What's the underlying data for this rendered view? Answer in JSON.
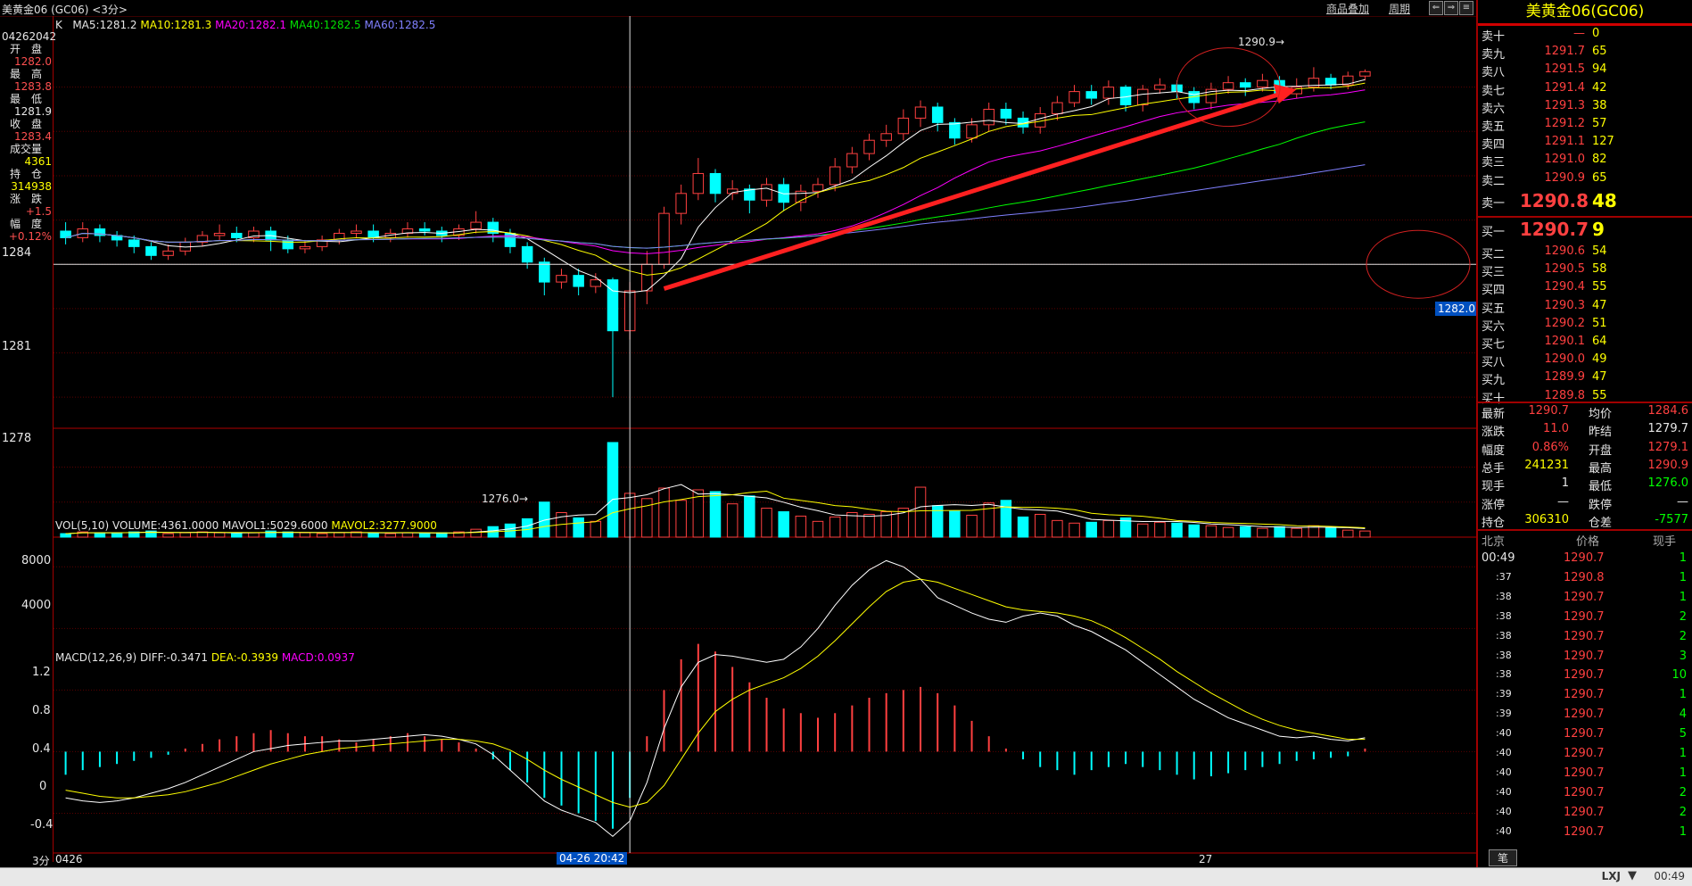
{
  "window": {
    "title": "美黄金06 (GC06) <3分>",
    "link_overlay": "商品叠加",
    "link_period": "周期"
  },
  "sidebar": {
    "code": "04262042",
    "open_label": "开　盘",
    "open_value": "1282.0",
    "high_label": "最　高",
    "high_value": "1283.8",
    "low_label": "最　低",
    "low_value": "1281.9",
    "close_label": "收　盘",
    "close_value": "1283.4",
    "vol_label": "成交量",
    "vol_value": "4361",
    "oi_label": "持　仓",
    "oi_value": "314938",
    "chg_label": "涨　跌",
    "chg_value": "+1.5",
    "pct_label": "幅　度",
    "pct_value": "+0.12%"
  },
  "main_chart": {
    "k_label": "K",
    "ma5": "MA5:1281.2",
    "ma10": "MA10:1281.3",
    "ma20": "MA20:1282.1",
    "ma40": "MA40:1282.5",
    "ma60": "MA60:1282.5",
    "y_ticks": [
      "1284",
      "1281",
      "1278"
    ],
    "annot_high": "1290.9",
    "annot_low": "1276.0",
    "crosshair_price": "1282.0"
  },
  "volume_chart": {
    "title": "VOL(5,10) VOLUME:4361.0000",
    "mavol1": "MAVOL1:5029.6000",
    "mavol2": "MAVOL2:3277.9000",
    "y_ticks": [
      "8000",
      "4000"
    ]
  },
  "macd_chart": {
    "title": "MACD(12,26,9)",
    "diff": "DIFF:-0.3471",
    "dea": "DEA:-0.3939",
    "macd": "MACD:0.0937",
    "y_ticks": [
      "1.2",
      "0.8",
      "0.4",
      "0",
      "-0.4"
    ]
  },
  "xaxis": {
    "period": "3分",
    "start": "0426",
    "cursor_time": "04-26 20:42",
    "mid_label": "27"
  },
  "chart_data": {
    "type": "candlestick",
    "price_range": [
      1275,
      1292
    ],
    "volume_range": [
      0,
      11000
    ],
    "macd_range": [
      -0.6,
      1.3
    ],
    "candles": [
      {
        "o": 1283.5,
        "c": 1283.2,
        "h": 1283.9,
        "l": 1282.9
      },
      {
        "o": 1283.2,
        "c": 1283.6,
        "h": 1283.9,
        "l": 1283.0
      },
      {
        "o": 1283.6,
        "c": 1283.3,
        "h": 1283.8,
        "l": 1283.0
      },
      {
        "o": 1283.3,
        "c": 1283.1,
        "h": 1283.5,
        "l": 1282.8
      },
      {
        "o": 1283.1,
        "c": 1282.8,
        "h": 1283.3,
        "l": 1282.5
      },
      {
        "o": 1282.8,
        "c": 1282.4,
        "h": 1283.0,
        "l": 1282.2
      },
      {
        "o": 1282.4,
        "c": 1282.6,
        "h": 1282.9,
        "l": 1282.2
      },
      {
        "o": 1282.6,
        "c": 1283.0,
        "h": 1283.2,
        "l": 1282.4
      },
      {
        "o": 1283.0,
        "c": 1283.3,
        "h": 1283.5,
        "l": 1282.8
      },
      {
        "o": 1283.3,
        "c": 1283.4,
        "h": 1283.8,
        "l": 1283.1
      },
      {
        "o": 1283.4,
        "c": 1283.2,
        "h": 1283.7,
        "l": 1283.0
      },
      {
        "o": 1283.2,
        "c": 1283.5,
        "h": 1283.7,
        "l": 1283.0
      },
      {
        "o": 1283.5,
        "c": 1283.1,
        "h": 1283.7,
        "l": 1282.6
      },
      {
        "o": 1283.1,
        "c": 1282.7,
        "h": 1283.3,
        "l": 1282.5
      },
      {
        "o": 1282.7,
        "c": 1282.8,
        "h": 1283.1,
        "l": 1282.5
      },
      {
        "o": 1282.8,
        "c": 1283.1,
        "h": 1283.3,
        "l": 1282.6
      },
      {
        "o": 1283.1,
        "c": 1283.4,
        "h": 1283.6,
        "l": 1282.9
      },
      {
        "o": 1283.4,
        "c": 1283.5,
        "h": 1283.8,
        "l": 1283.2
      },
      {
        "o": 1283.5,
        "c": 1283.2,
        "h": 1283.8,
        "l": 1283.0
      },
      {
        "o": 1283.2,
        "c": 1283.4,
        "h": 1283.6,
        "l": 1283.0
      },
      {
        "o": 1283.4,
        "c": 1283.6,
        "h": 1283.9,
        "l": 1283.2
      },
      {
        "o": 1283.6,
        "c": 1283.5,
        "h": 1283.9,
        "l": 1283.3
      },
      {
        "o": 1283.5,
        "c": 1283.3,
        "h": 1283.7,
        "l": 1283.0
      },
      {
        "o": 1283.3,
        "c": 1283.6,
        "h": 1283.8,
        "l": 1283.1
      },
      {
        "o": 1283.6,
        "c": 1283.9,
        "h": 1284.4,
        "l": 1283.4
      },
      {
        "o": 1283.9,
        "c": 1283.4,
        "h": 1284.1,
        "l": 1283.0
      },
      {
        "o": 1283.4,
        "c": 1282.8,
        "h": 1283.6,
        "l": 1282.5
      },
      {
        "o": 1282.8,
        "c": 1282.1,
        "h": 1283.0,
        "l": 1281.8
      },
      {
        "o": 1282.1,
        "c": 1281.2,
        "h": 1282.3,
        "l": 1280.6
      },
      {
        "o": 1281.2,
        "c": 1281.5,
        "h": 1281.8,
        "l": 1280.9
      },
      {
        "o": 1281.5,
        "c": 1281.0,
        "h": 1281.8,
        "l": 1280.6
      },
      {
        "o": 1281.0,
        "c": 1281.3,
        "h": 1281.6,
        "l": 1280.7
      },
      {
        "o": 1281.3,
        "c": 1279.0,
        "h": 1281.4,
        "l": 1276.0
      },
      {
        "o": 1279.0,
        "c": 1280.8,
        "h": 1281.2,
        "l": 1278.6
      },
      {
        "o": 1280.8,
        "c": 1282.0,
        "h": 1282.6,
        "l": 1280.2
      },
      {
        "o": 1282.0,
        "c": 1284.3,
        "h": 1284.6,
        "l": 1281.8
      },
      {
        "o": 1284.3,
        "c": 1285.2,
        "h": 1285.6,
        "l": 1283.8
      },
      {
        "o": 1285.2,
        "c": 1286.1,
        "h": 1286.8,
        "l": 1284.9
      },
      {
        "o": 1286.1,
        "c": 1285.2,
        "h": 1286.3,
        "l": 1284.8
      },
      {
        "o": 1285.2,
        "c": 1285.4,
        "h": 1285.8,
        "l": 1284.9
      },
      {
        "o": 1285.4,
        "c": 1284.9,
        "h": 1285.6,
        "l": 1284.3
      },
      {
        "o": 1284.9,
        "c": 1285.6,
        "h": 1285.9,
        "l": 1284.6
      },
      {
        "o": 1285.6,
        "c": 1284.8,
        "h": 1285.9,
        "l": 1284.4
      },
      {
        "o": 1284.8,
        "c": 1285.3,
        "h": 1285.6,
        "l": 1284.4
      },
      {
        "o": 1285.3,
        "c": 1285.6,
        "h": 1285.9,
        "l": 1285.0
      },
      {
        "o": 1285.6,
        "c": 1286.4,
        "h": 1286.8,
        "l": 1285.3
      },
      {
        "o": 1286.4,
        "c": 1287.0,
        "h": 1287.3,
        "l": 1286.1
      },
      {
        "o": 1287.0,
        "c": 1287.6,
        "h": 1287.9,
        "l": 1286.7
      },
      {
        "o": 1287.6,
        "c": 1287.9,
        "h": 1288.3,
        "l": 1287.3
      },
      {
        "o": 1287.9,
        "c": 1288.6,
        "h": 1289.0,
        "l": 1287.6
      },
      {
        "o": 1288.6,
        "c": 1289.1,
        "h": 1289.4,
        "l": 1288.2
      },
      {
        "o": 1289.1,
        "c": 1288.4,
        "h": 1289.3,
        "l": 1288.0
      },
      {
        "o": 1288.4,
        "c": 1287.7,
        "h": 1288.6,
        "l": 1287.4
      },
      {
        "o": 1287.7,
        "c": 1288.3,
        "h": 1288.6,
        "l": 1287.5
      },
      {
        "o": 1288.3,
        "c": 1289.0,
        "h": 1289.3,
        "l": 1288.0
      },
      {
        "o": 1289.0,
        "c": 1288.6,
        "h": 1289.3,
        "l": 1288.3
      },
      {
        "o": 1288.6,
        "c": 1288.2,
        "h": 1288.9,
        "l": 1287.9
      },
      {
        "o": 1288.2,
        "c": 1288.8,
        "h": 1289.1,
        "l": 1287.9
      },
      {
        "o": 1288.8,
        "c": 1289.3,
        "h": 1289.6,
        "l": 1288.5
      },
      {
        "o": 1289.3,
        "c": 1289.8,
        "h": 1290.1,
        "l": 1289.1
      },
      {
        "o": 1289.8,
        "c": 1289.5,
        "h": 1290.1,
        "l": 1289.2
      },
      {
        "o": 1289.5,
        "c": 1290.0,
        "h": 1290.3,
        "l": 1289.2
      },
      {
        "o": 1290.0,
        "c": 1289.2,
        "h": 1290.1,
        "l": 1288.9
      },
      {
        "o": 1289.2,
        "c": 1289.9,
        "h": 1290.1,
        "l": 1288.9
      },
      {
        "o": 1289.9,
        "c": 1290.1,
        "h": 1290.4,
        "l": 1289.7
      },
      {
        "o": 1290.1,
        "c": 1289.8,
        "h": 1290.3,
        "l": 1289.5
      },
      {
        "o": 1289.8,
        "c": 1289.3,
        "h": 1290.0,
        "l": 1289.0
      },
      {
        "o": 1289.3,
        "c": 1289.9,
        "h": 1290.2,
        "l": 1289.0
      },
      {
        "o": 1289.9,
        "c": 1290.2,
        "h": 1290.5,
        "l": 1289.7
      },
      {
        "o": 1290.2,
        "c": 1290.0,
        "h": 1290.4,
        "l": 1289.6
      },
      {
        "o": 1290.0,
        "c": 1290.3,
        "h": 1290.6,
        "l": 1289.8
      },
      {
        "o": 1290.3,
        "c": 1289.7,
        "h": 1290.5,
        "l": 1289.4
      },
      {
        "o": 1289.7,
        "c": 1290.0,
        "h": 1290.4,
        "l": 1289.5
      },
      {
        "o": 1290.0,
        "c": 1290.4,
        "h": 1290.9,
        "l": 1289.8
      },
      {
        "o": 1290.4,
        "c": 1290.1,
        "h": 1290.6,
        "l": 1289.9
      },
      {
        "o": 1290.1,
        "c": 1290.5,
        "h": 1290.7,
        "l": 1289.9
      },
      {
        "o": 1290.5,
        "c": 1290.7,
        "h": 1290.8,
        "l": 1290.3
      }
    ],
    "volume": [
      400,
      600,
      500,
      500,
      600,
      700,
      400,
      500,
      600,
      500,
      400,
      500,
      700,
      600,
      500,
      400,
      500,
      600,
      500,
      400,
      500,
      400,
      500,
      600,
      900,
      1200,
      1500,
      2100,
      4000,
      2800,
      2200,
      1800,
      10800,
      5000,
      4400,
      5600,
      4200,
      5400,
      5200,
      3800,
      4700,
      3300,
      2900,
      2400,
      1800,
      2300,
      2800,
      2600,
      2900,
      3300,
      5700,
      3600,
      3000,
      2500,
      3900,
      4200,
      2300,
      2600,
      1900,
      1600,
      1700,
      1900,
      2200,
      1500,
      1700,
      1600,
      1400,
      1300,
      1100,
      1200,
      1000,
      1200,
      1000,
      1300,
      1100,
      800,
      700
    ],
    "macd_hist": [
      -0.15,
      -0.12,
      -0.1,
      -0.08,
      -0.06,
      -0.04,
      -0.02,
      0.02,
      0.05,
      0.08,
      0.1,
      0.12,
      0.14,
      0.12,
      0.1,
      0.1,
      0.08,
      0.06,
      0.08,
      0.1,
      0.12,
      0.1,
      0.08,
      0.06,
      0.02,
      -0.05,
      -0.12,
      -0.2,
      -0.3,
      -0.35,
      -0.4,
      -0.45,
      -0.5,
      -0.3,
      0.1,
      0.4,
      0.6,
      0.7,
      0.65,
      0.55,
      0.45,
      0.35,
      0.28,
      0.25,
      0.22,
      0.25,
      0.3,
      0.35,
      0.38,
      0.4,
      0.42,
      0.38,
      0.3,
      0.2,
      0.1,
      0.02,
      -0.05,
      -0.1,
      -0.12,
      -0.15,
      -0.12,
      -0.1,
      -0.08,
      -0.1,
      -0.12,
      -0.15,
      -0.18,
      -0.16,
      -0.14,
      -0.12,
      -0.1,
      -0.08,
      -0.06,
      -0.05,
      -0.04,
      -0.03,
      0.02
    ],
    "diff": [
      -0.3,
      -0.32,
      -0.33,
      -0.32,
      -0.3,
      -0.27,
      -0.24,
      -0.2,
      -0.15,
      -0.1,
      -0.05,
      0,
      0.02,
      0.04,
      0.05,
      0.06,
      0.07,
      0.07,
      0.08,
      0.09,
      0.1,
      0.11,
      0.1,
      0.08,
      0.05,
      -0.02,
      -0.12,
      -0.22,
      -0.32,
      -0.38,
      -0.42,
      -0.46,
      -0.55,
      -0.45,
      -0.2,
      0.15,
      0.42,
      0.58,
      0.63,
      0.62,
      0.6,
      0.58,
      0.6,
      0.68,
      0.8,
      0.95,
      1.08,
      1.18,
      1.24,
      1.2,
      1.12,
      1.0,
      0.95,
      0.9,
      0.86,
      0.84,
      0.88,
      0.9,
      0.88,
      0.82,
      0.78,
      0.72,
      0.66,
      0.58,
      0.5,
      0.42,
      0.34,
      0.28,
      0.22,
      0.18,
      0.14,
      0.1,
      0.09,
      0.1,
      0.08,
      0.07,
      0.09
    ],
    "dea": [
      -0.25,
      -0.27,
      -0.29,
      -0.3,
      -0.3,
      -0.29,
      -0.28,
      -0.26,
      -0.23,
      -0.2,
      -0.16,
      -0.12,
      -0.08,
      -0.05,
      -0.02,
      0,
      0.02,
      0.03,
      0.04,
      0.05,
      0.06,
      0.07,
      0.08,
      0.08,
      0.07,
      0.05,
      0.01,
      -0.05,
      -0.12,
      -0.18,
      -0.23,
      -0.28,
      -0.33,
      -0.36,
      -0.33,
      -0.22,
      -0.05,
      0.12,
      0.26,
      0.34,
      0.4,
      0.44,
      0.48,
      0.54,
      0.62,
      0.72,
      0.83,
      0.94,
      1.04,
      1.1,
      1.12,
      1.1,
      1.06,
      1.02,
      0.98,
      0.94,
      0.92,
      0.91,
      0.9,
      0.88,
      0.85,
      0.8,
      0.74,
      0.67,
      0.6,
      0.52,
      0.45,
      0.38,
      0.32,
      0.26,
      0.21,
      0.17,
      0.14,
      0.12,
      0.1,
      0.08,
      0.08
    ]
  },
  "orderbook": {
    "title": "美黄金06(GC06)",
    "asks": [
      {
        "label": "卖十",
        "price": "—",
        "vol": "0"
      },
      {
        "label": "卖九",
        "price": "1291.7",
        "vol": "65"
      },
      {
        "label": "卖八",
        "price": "1291.5",
        "vol": "94"
      },
      {
        "label": "卖七",
        "price": "1291.4",
        "vol": "42"
      },
      {
        "label": "卖六",
        "price": "1291.3",
        "vol": "38"
      },
      {
        "label": "卖五",
        "price": "1291.2",
        "vol": "57"
      },
      {
        "label": "卖四",
        "price": "1291.1",
        "vol": "127"
      },
      {
        "label": "卖三",
        "price": "1291.0",
        "vol": "82"
      },
      {
        "label": "卖二",
        "price": "1290.9",
        "vol": "65"
      }
    ],
    "ask1": {
      "label": "卖一",
      "price": "1290.8",
      "vol": "48"
    },
    "bid1": {
      "label": "买一",
      "price": "1290.7",
      "vol": "9"
    },
    "bids": [
      {
        "label": "买二",
        "price": "1290.6",
        "vol": "54"
      },
      {
        "label": "买三",
        "price": "1290.5",
        "vol": "58"
      },
      {
        "label": "买四",
        "price": "1290.4",
        "vol": "55"
      },
      {
        "label": "买五",
        "price": "1290.3",
        "vol": "47"
      },
      {
        "label": "买六",
        "price": "1290.2",
        "vol": "51"
      },
      {
        "label": "买七",
        "price": "1290.1",
        "vol": "64"
      },
      {
        "label": "买八",
        "price": "1290.0",
        "vol": "49"
      },
      {
        "label": "买九",
        "price": "1289.9",
        "vol": "47"
      },
      {
        "label": "买十",
        "price": "1289.8",
        "vol": "55"
      }
    ]
  },
  "quote_stats": [
    {
      "l1": "最新",
      "v1": "1290.7",
      "l2": "均价",
      "v2": "1284.6"
    },
    {
      "l1": "涨跌",
      "v1": "11.0",
      "l2": "昨结",
      "v2": "1279.7"
    },
    {
      "l1": "幅度",
      "v1": "0.86%",
      "l2": "开盘",
      "v2": "1279.1"
    },
    {
      "l1": "总手",
      "v1": "241231",
      "l2": "最高",
      "v2": "1290.9"
    },
    {
      "l1": "现手",
      "v1": "1",
      "l2": "最低",
      "v2": "1276.0"
    },
    {
      "l1": "涨停",
      "v1": "—",
      "l2": "跌停",
      "v2": "—"
    },
    {
      "l1": "持仓",
      "v1": "306310",
      "l2": "仓差",
      "v2": "-7577"
    }
  ],
  "ticks_header": {
    "time": "北京",
    "price": "价格",
    "vol": "现手"
  },
  "ticks": [
    {
      "t": "00:49",
      "p": "1290.7",
      "v": "1"
    },
    {
      "t": ":37",
      "p": "1290.8",
      "v": "1"
    },
    {
      "t": ":38",
      "p": "1290.7",
      "v": "1"
    },
    {
      "t": ":38",
      "p": "1290.7",
      "v": "2"
    },
    {
      "t": ":38",
      "p": "1290.7",
      "v": "2"
    },
    {
      "t": ":38",
      "p": "1290.7",
      "v": "3"
    },
    {
      "t": ":38",
      "p": "1290.7",
      "v": "10"
    },
    {
      "t": ":39",
      "p": "1290.7",
      "v": "1"
    },
    {
      "t": ":39",
      "p": "1290.7",
      "v": "4"
    },
    {
      "t": ":40",
      "p": "1290.7",
      "v": "5"
    },
    {
      "t": ":40",
      "p": "1290.7",
      "v": "1"
    },
    {
      "t": ":40",
      "p": "1290.7",
      "v": "1"
    },
    {
      "t": ":40",
      "p": "1290.7",
      "v": "2"
    },
    {
      "t": ":40",
      "p": "1290.7",
      "v": "2"
    },
    {
      "t": ":40",
      "p": "1290.7",
      "v": "1"
    }
  ],
  "bottom_tab": "笔",
  "status": {
    "brand": "LXJ",
    "time": "00:49"
  },
  "colors": {
    "up": "#ff4040",
    "down": "#00ffff",
    "ma5": "#ffffff",
    "ma10": "#ffff00",
    "ma20": "#ff00ff",
    "ma40": "#00ff00",
    "ma60": "#8080ff",
    "arrow": "#ff2020"
  }
}
